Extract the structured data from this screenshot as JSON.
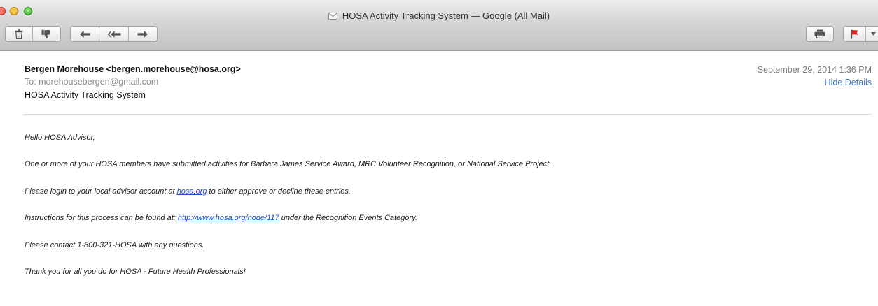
{
  "window": {
    "title": "HOSA Activity Tracking System — Google (All Mail)"
  },
  "toolbar": {
    "left_buttons": [
      "trash-icon",
      "junk-thumbs-down-icon"
    ],
    "reply_buttons": [
      "reply-icon",
      "reply-all-icon",
      "forward-icon"
    ],
    "right_buttons": [
      "print-icon",
      "flag-icon"
    ]
  },
  "message": {
    "from": "Bergen Morehouse <bergen.morehouse@hosa.org>",
    "to": "To:  morehousebergen@gmail.com",
    "subject": "HOSA Activity Tracking System",
    "date": "September 29, 2014  1:36 PM",
    "hide_details": "Hide Details"
  },
  "body": {
    "greeting": "Hello HOSA Advisor,",
    "para1": "One or more of your HOSA members have submitted activities for Barbara James Service Award, MRC Volunteer Recognition, or National Service Project.",
    "para2_before": "Please login to your local advisor account at ",
    "para2_link": "hosa.org",
    "para2_after": " to either approve or decline these entries.",
    "para3_before": "Instructions for this process can be found at: ",
    "para3_link": "http://www.hosa.org/node/117",
    "para3_after": " under the Recognition Events Category.",
    "para4": "Please contact 1-800-321-HOSA with any questions.",
    "para5": "Thank you for all you do for HOSA - Future Health Professionals!"
  },
  "colors": {
    "link": "#1f4fd1",
    "hide_details": "#3b74c8",
    "close_button": "#e0443a",
    "minimize_button": "#e3a514",
    "zoom_button": "#3cad2c",
    "flag": "#d9262a"
  }
}
